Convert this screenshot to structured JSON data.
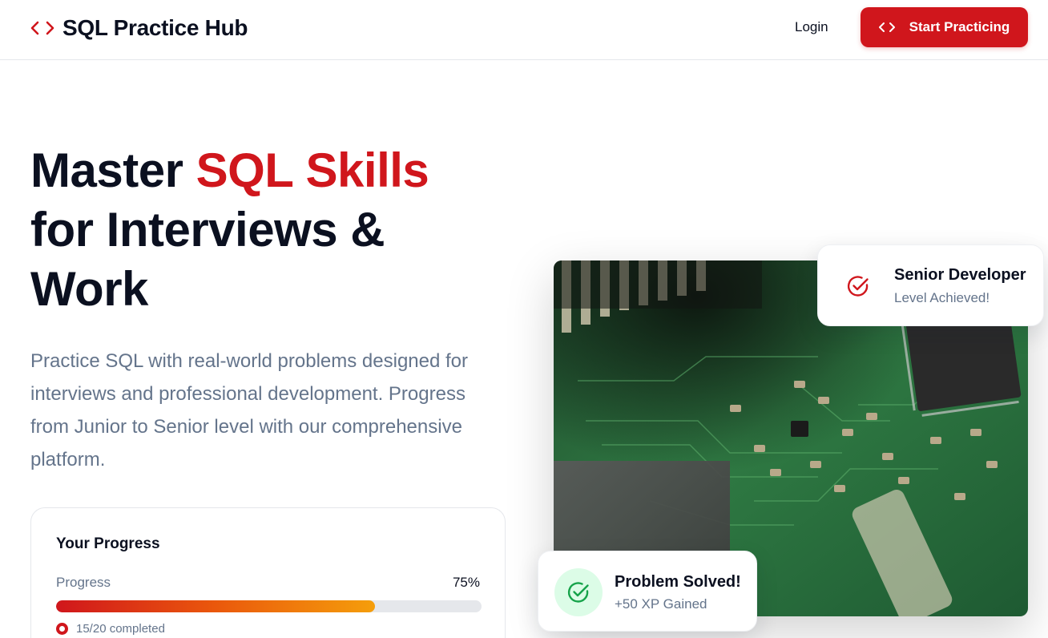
{
  "header": {
    "brand_title": "SQL Practice Hub",
    "login_label": "Login",
    "cta_label": "Start Practicing"
  },
  "hero": {
    "title_part1": "Master ",
    "title_accent": "SQL Skills",
    "title_part2": "for Interviews & Work",
    "subtitle": "Practice SQL with real-world problems designed for interviews and professional development. Progress from Junior to Senior level with our comprehensive platform."
  },
  "progress_card": {
    "title": "Your Progress",
    "label": "Progress",
    "percent_text": "75%",
    "percent_value": 0.75,
    "completed_text": "15/20 completed"
  },
  "achievement_card": {
    "title": "Senior Developer",
    "subtitle": "Level Achieved!"
  },
  "solved_card": {
    "title": "Problem Solved!",
    "subtitle": "+50 XP Gained"
  },
  "icons": {
    "brand": "code-brackets-icon",
    "cta": "code-brackets-icon",
    "achievement": "check-circle-icon",
    "solved": "check-circle-icon"
  },
  "colors": {
    "accent": "#d0161c",
    "text_dark": "#0b1020",
    "text_muted": "#64748b",
    "success": "#16a34a",
    "success_bg": "#dcfce7",
    "progress_start": "#d0161c",
    "progress_end": "#f59e0b"
  }
}
